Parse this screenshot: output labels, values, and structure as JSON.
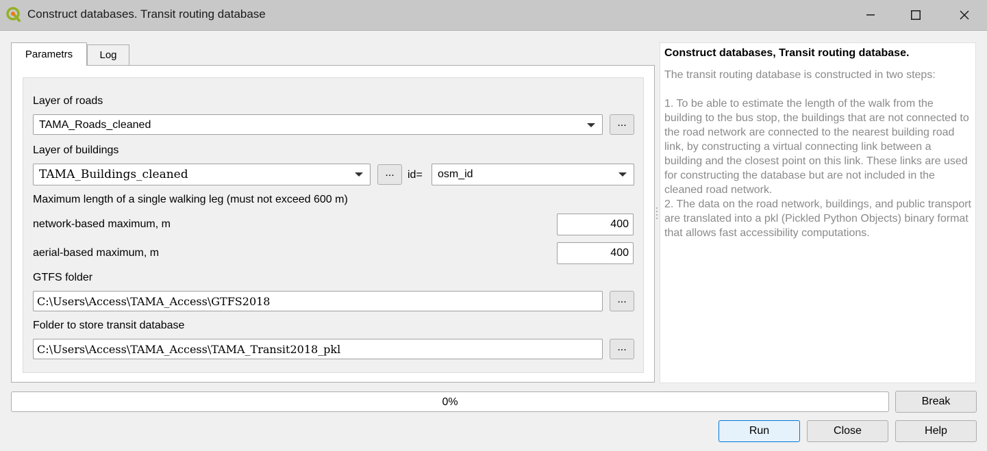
{
  "window": {
    "title": "Construct databases. Transit routing database",
    "icon": "qgis-icon",
    "controls": [
      "minimize-icon",
      "maximize-icon",
      "close-icon"
    ]
  },
  "tabs": [
    {
      "label": "Parametrs",
      "active": true
    },
    {
      "label": "Log",
      "active": false
    }
  ],
  "form": {
    "roads": {
      "label": "Layer of roads",
      "value": "TAMA_Roads_cleaned",
      "browse": "..."
    },
    "buildings": {
      "label": "Layer of buildings",
      "value": "TAMA_Buildings_cleaned",
      "browse": "...",
      "id_label": "id=",
      "id_value": "osm_id"
    },
    "walk": {
      "label": "Maximum length of a single walking leg (must not exceed 600 m)",
      "network_label": "network-based maximum, m",
      "network_value": "400",
      "aerial_label": "aerial-based maximum, m",
      "aerial_value": "400"
    },
    "gtfs": {
      "label": "GTFS folder",
      "value": "C:\\Users\\Access\\TAMA_Access\\GTFS2018",
      "browse": "..."
    },
    "output": {
      "label": "Folder to store transit database",
      "value": "C:\\Users\\Access\\TAMA_Access\\TAMA_Transit2018_pkl",
      "browse": "..."
    }
  },
  "help": {
    "title": "Construct databases, Transit routing database.",
    "intro": "The transit routing database is constructed in two steps:",
    "step1": "1. To be able to estimate the length of the walk from the building to the bus stop, the buildings that are not connected to the road network are connected to the nearest building road link, by constructing a virtual connecting link between a building and the closest point on this link. These links are used for constructing the database but are not included in the cleaned road network.",
    "step2": "2. The data on the road network, buildings, and public transport are translated into a pkl (Pickled Python Objects) binary format that allows fast accessibility computations."
  },
  "progress": {
    "text": "0%",
    "value": 0
  },
  "buttons": {
    "break": "Break",
    "run": "Run",
    "close": "Close",
    "help": "Help"
  }
}
